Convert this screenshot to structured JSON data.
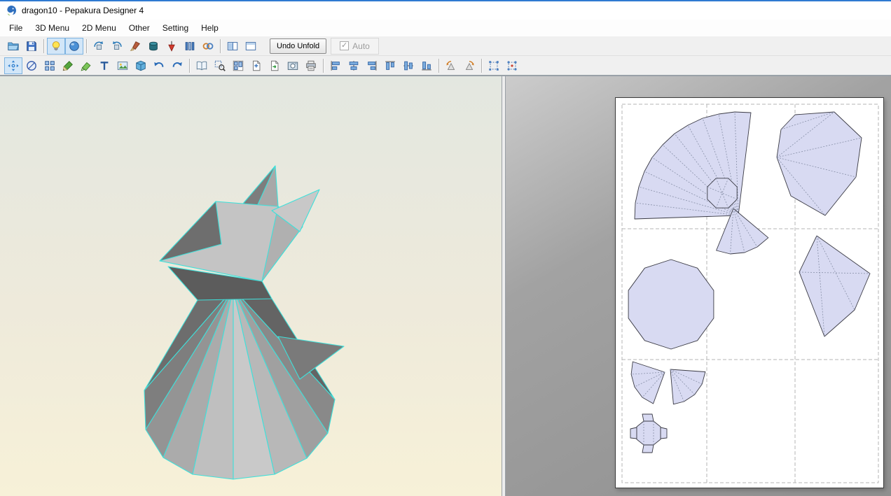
{
  "window": {
    "title": "dragon10 - Pepakura Designer 4",
    "app_icon": "pepakura-logo-icon"
  },
  "menu_bar": {
    "items": [
      "File",
      "3D Menu",
      "2D Menu",
      "Other",
      "Setting",
      "Help"
    ]
  },
  "toolbar_top": {
    "items": [
      {
        "type": "icon",
        "name": "open-file"
      },
      {
        "type": "icon",
        "name": "save-file"
      },
      {
        "type": "separator"
      },
      {
        "type": "icon",
        "name": "light-toggle",
        "active": true
      },
      {
        "type": "icon",
        "name": "texture-view",
        "active": true
      },
      {
        "type": "separator"
      },
      {
        "type": "icon",
        "name": "rotate-view-left"
      },
      {
        "type": "icon",
        "name": "rotate-view-right"
      },
      {
        "type": "icon",
        "name": "paint-material"
      },
      {
        "type": "icon",
        "name": "material-cylinder"
      },
      {
        "type": "icon",
        "name": "plumb-measure"
      },
      {
        "type": "icon",
        "name": "scale-bars"
      },
      {
        "type": "icon",
        "name": "joint-link"
      },
      {
        "type": "separator"
      },
      {
        "type": "icon",
        "name": "split-window"
      },
      {
        "type": "icon",
        "name": "single-window"
      }
    ],
    "undo_unfold_label": "Undo Unfold",
    "auto_checkbox": {
      "label": "Auto",
      "checked": true,
      "enabled": false
    }
  },
  "toolbar_2d": {
    "items": [
      {
        "type": "icon",
        "name": "pan-tool",
        "active": true
      },
      {
        "type": "icon",
        "name": "select-disc"
      },
      {
        "type": "icon",
        "name": "divide-parts"
      },
      {
        "type": "icon",
        "name": "edge-pencil"
      },
      {
        "type": "icon",
        "name": "flap-brush"
      },
      {
        "type": "icon",
        "name": "insert-text"
      },
      {
        "type": "icon",
        "name": "insert-image"
      },
      {
        "type": "icon",
        "name": "parts-box"
      },
      {
        "type": "icon",
        "name": "undo"
      },
      {
        "type": "icon",
        "name": "redo"
      },
      {
        "type": "separator"
      },
      {
        "type": "icon",
        "name": "book-layout"
      },
      {
        "type": "icon",
        "name": "zoom-select"
      },
      {
        "type": "icon",
        "name": "auto-layout"
      },
      {
        "type": "icon",
        "name": "add-page"
      },
      {
        "type": "icon",
        "name": "export-page"
      },
      {
        "type": "icon",
        "name": "capture-view"
      },
      {
        "type": "icon",
        "name": "print"
      },
      {
        "type": "separator"
      },
      {
        "type": "icon",
        "name": "align-left"
      },
      {
        "type": "icon",
        "name": "align-center-h"
      },
      {
        "type": "icon",
        "name": "align-right"
      },
      {
        "type": "icon",
        "name": "align-top"
      },
      {
        "type": "icon",
        "name": "align-center-v"
      },
      {
        "type": "icon",
        "name": "align-bottom"
      },
      {
        "type": "separator"
      },
      {
        "type": "icon",
        "name": "rotate-ccw"
      },
      {
        "type": "icon",
        "name": "rotate-cw"
      },
      {
        "type": "separator"
      },
      {
        "type": "icon",
        "name": "snap-grid"
      },
      {
        "type": "icon",
        "name": "snap-vertices"
      }
    ]
  },
  "colors": {
    "accent_blue": "#2f7ad1",
    "toolbar_bg": "#f0f0f0",
    "edge_highlight": "#3fe0da",
    "piece_fill": "#d8daf2",
    "piece_outline": "#3a3a44",
    "view3d_top": "#e3e7e0",
    "view3d_bottom": "#f7f1d8",
    "view2d_bg": "#8f8f8f"
  }
}
